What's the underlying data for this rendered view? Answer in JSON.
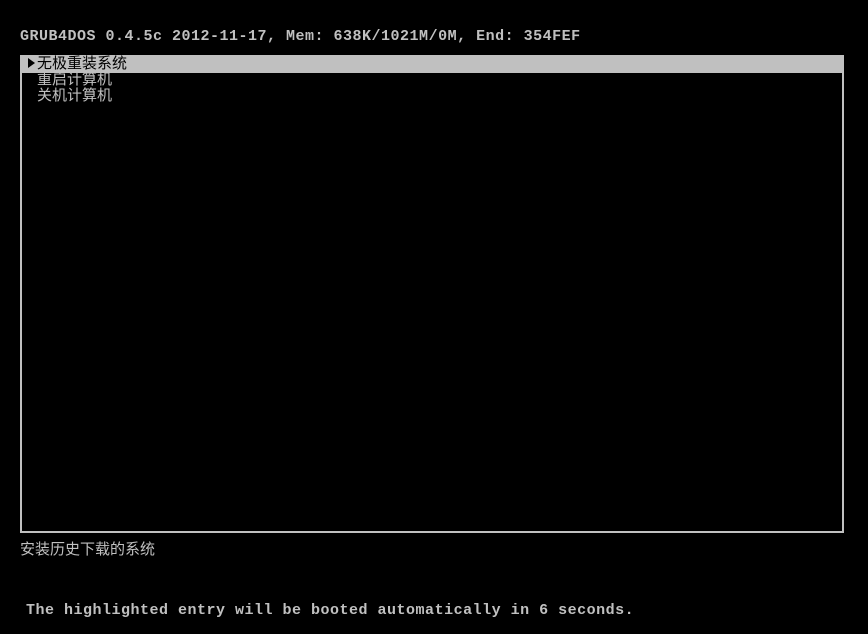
{
  "header": {
    "text": "GRUB4DOS 0.4.5c 2012-11-17, Mem: 638K/1021M/0M, End: 354FEF"
  },
  "menu": {
    "items": [
      {
        "label": "无极重装系统",
        "selected": true
      },
      {
        "label": "重启计算机",
        "selected": false
      },
      {
        "label": "关机计算机",
        "selected": false
      }
    ]
  },
  "description": {
    "text": "安装历史下载的系统"
  },
  "footer": {
    "text": "The highlighted entry will be booted automatically in 6 seconds."
  }
}
